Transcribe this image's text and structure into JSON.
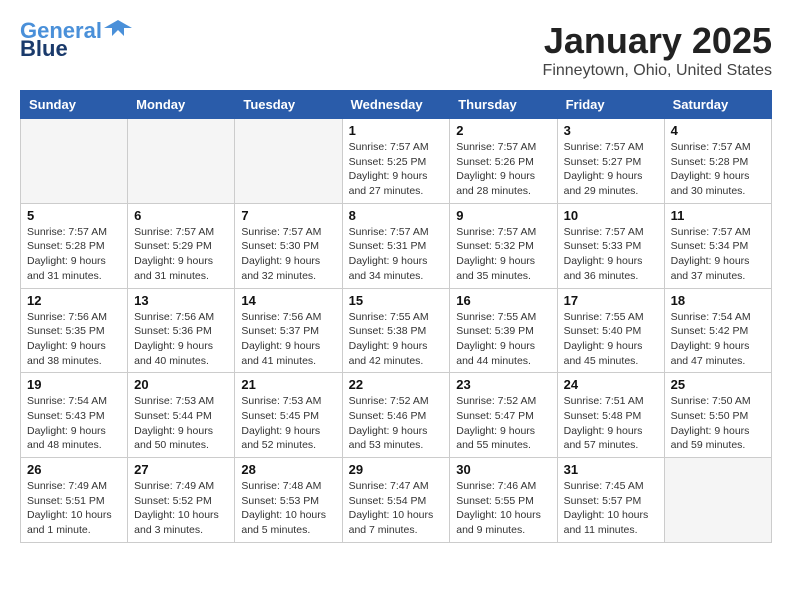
{
  "header": {
    "logo_line1": "General",
    "logo_line2": "Blue",
    "month": "January 2025",
    "location": "Finneytown, Ohio, United States"
  },
  "weekdays": [
    "Sunday",
    "Monday",
    "Tuesday",
    "Wednesday",
    "Thursday",
    "Friday",
    "Saturday"
  ],
  "weeks": [
    [
      {
        "day": "",
        "info": ""
      },
      {
        "day": "",
        "info": ""
      },
      {
        "day": "",
        "info": ""
      },
      {
        "day": "1",
        "info": "Sunrise: 7:57 AM\nSunset: 5:25 PM\nDaylight: 9 hours\nand 27 minutes."
      },
      {
        "day": "2",
        "info": "Sunrise: 7:57 AM\nSunset: 5:26 PM\nDaylight: 9 hours\nand 28 minutes."
      },
      {
        "day": "3",
        "info": "Sunrise: 7:57 AM\nSunset: 5:27 PM\nDaylight: 9 hours\nand 29 minutes."
      },
      {
        "day": "4",
        "info": "Sunrise: 7:57 AM\nSunset: 5:28 PM\nDaylight: 9 hours\nand 30 minutes."
      }
    ],
    [
      {
        "day": "5",
        "info": "Sunrise: 7:57 AM\nSunset: 5:28 PM\nDaylight: 9 hours\nand 31 minutes."
      },
      {
        "day": "6",
        "info": "Sunrise: 7:57 AM\nSunset: 5:29 PM\nDaylight: 9 hours\nand 31 minutes."
      },
      {
        "day": "7",
        "info": "Sunrise: 7:57 AM\nSunset: 5:30 PM\nDaylight: 9 hours\nand 32 minutes."
      },
      {
        "day": "8",
        "info": "Sunrise: 7:57 AM\nSunset: 5:31 PM\nDaylight: 9 hours\nand 34 minutes."
      },
      {
        "day": "9",
        "info": "Sunrise: 7:57 AM\nSunset: 5:32 PM\nDaylight: 9 hours\nand 35 minutes."
      },
      {
        "day": "10",
        "info": "Sunrise: 7:57 AM\nSunset: 5:33 PM\nDaylight: 9 hours\nand 36 minutes."
      },
      {
        "day": "11",
        "info": "Sunrise: 7:57 AM\nSunset: 5:34 PM\nDaylight: 9 hours\nand 37 minutes."
      }
    ],
    [
      {
        "day": "12",
        "info": "Sunrise: 7:56 AM\nSunset: 5:35 PM\nDaylight: 9 hours\nand 38 minutes."
      },
      {
        "day": "13",
        "info": "Sunrise: 7:56 AM\nSunset: 5:36 PM\nDaylight: 9 hours\nand 40 minutes."
      },
      {
        "day": "14",
        "info": "Sunrise: 7:56 AM\nSunset: 5:37 PM\nDaylight: 9 hours\nand 41 minutes."
      },
      {
        "day": "15",
        "info": "Sunrise: 7:55 AM\nSunset: 5:38 PM\nDaylight: 9 hours\nand 42 minutes."
      },
      {
        "day": "16",
        "info": "Sunrise: 7:55 AM\nSunset: 5:39 PM\nDaylight: 9 hours\nand 44 minutes."
      },
      {
        "day": "17",
        "info": "Sunrise: 7:55 AM\nSunset: 5:40 PM\nDaylight: 9 hours\nand 45 minutes."
      },
      {
        "day": "18",
        "info": "Sunrise: 7:54 AM\nSunset: 5:42 PM\nDaylight: 9 hours\nand 47 minutes."
      }
    ],
    [
      {
        "day": "19",
        "info": "Sunrise: 7:54 AM\nSunset: 5:43 PM\nDaylight: 9 hours\nand 48 minutes."
      },
      {
        "day": "20",
        "info": "Sunrise: 7:53 AM\nSunset: 5:44 PM\nDaylight: 9 hours\nand 50 minutes."
      },
      {
        "day": "21",
        "info": "Sunrise: 7:53 AM\nSunset: 5:45 PM\nDaylight: 9 hours\nand 52 minutes."
      },
      {
        "day": "22",
        "info": "Sunrise: 7:52 AM\nSunset: 5:46 PM\nDaylight: 9 hours\nand 53 minutes."
      },
      {
        "day": "23",
        "info": "Sunrise: 7:52 AM\nSunset: 5:47 PM\nDaylight: 9 hours\nand 55 minutes."
      },
      {
        "day": "24",
        "info": "Sunrise: 7:51 AM\nSunset: 5:48 PM\nDaylight: 9 hours\nand 57 minutes."
      },
      {
        "day": "25",
        "info": "Sunrise: 7:50 AM\nSunset: 5:50 PM\nDaylight: 9 hours\nand 59 minutes."
      }
    ],
    [
      {
        "day": "26",
        "info": "Sunrise: 7:49 AM\nSunset: 5:51 PM\nDaylight: 10 hours\nand 1 minute."
      },
      {
        "day": "27",
        "info": "Sunrise: 7:49 AM\nSunset: 5:52 PM\nDaylight: 10 hours\nand 3 minutes."
      },
      {
        "day": "28",
        "info": "Sunrise: 7:48 AM\nSunset: 5:53 PM\nDaylight: 10 hours\nand 5 minutes."
      },
      {
        "day": "29",
        "info": "Sunrise: 7:47 AM\nSunset: 5:54 PM\nDaylight: 10 hours\nand 7 minutes."
      },
      {
        "day": "30",
        "info": "Sunrise: 7:46 AM\nSunset: 5:55 PM\nDaylight: 10 hours\nand 9 minutes."
      },
      {
        "day": "31",
        "info": "Sunrise: 7:45 AM\nSunset: 5:57 PM\nDaylight: 10 hours\nand 11 minutes."
      },
      {
        "day": "",
        "info": ""
      }
    ]
  ]
}
